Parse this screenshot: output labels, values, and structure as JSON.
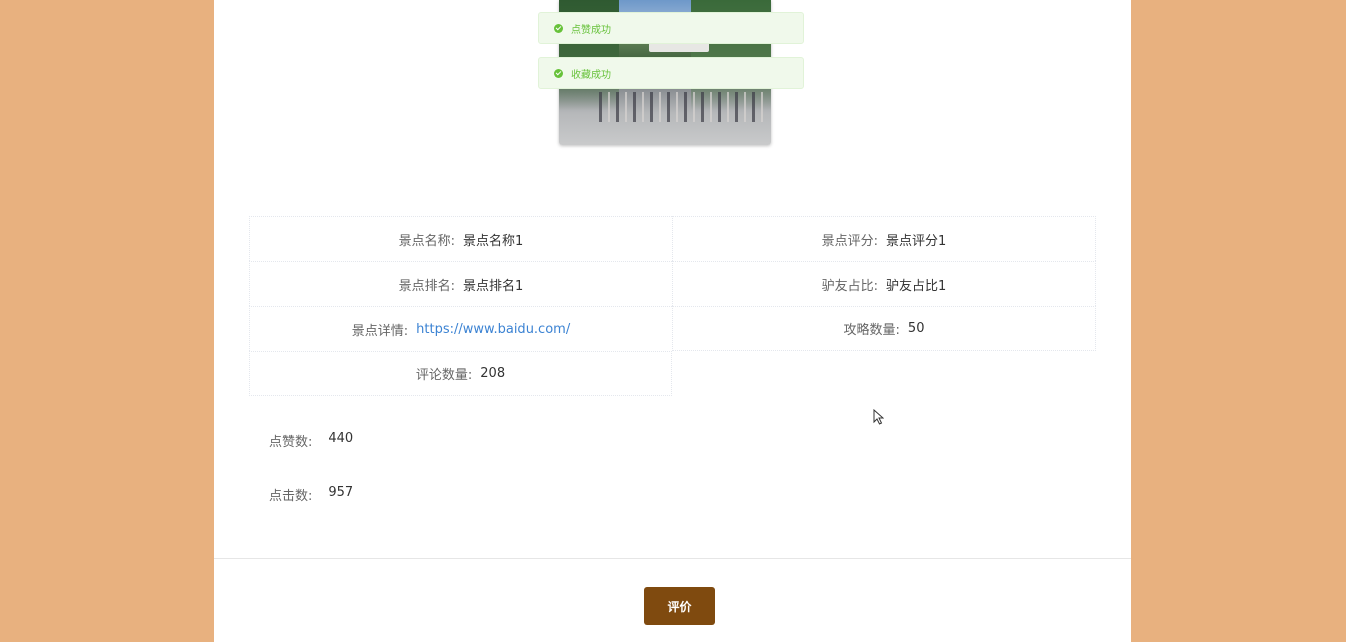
{
  "toasts": [
    "点赞成功",
    "收藏成功"
  ],
  "details": {
    "name_label": "景点名称:",
    "name_value": "景点名称1",
    "score_label": "景点评分:",
    "score_value": "景点评分1",
    "rank_label": "景点排名:",
    "rank_value": "景点排名1",
    "ratio_label": "驴友占比:",
    "ratio_value": "驴友占比1",
    "detail_label": "景点详情:",
    "detail_value": "https://www.baidu.com/",
    "guide_label": "攻略数量:",
    "guide_value": "50",
    "comment_label": "评论数量:",
    "comment_value": "208"
  },
  "stats": {
    "likes_label": "点赞数:",
    "likes_value": "440",
    "clicks_label": "点击数:",
    "clicks_value": "957"
  },
  "review_button": "评价",
  "colors": {
    "accent": "#7f4a0f",
    "background": "#e8b17f",
    "success": "#67c23a",
    "link": "#3c83d3"
  }
}
